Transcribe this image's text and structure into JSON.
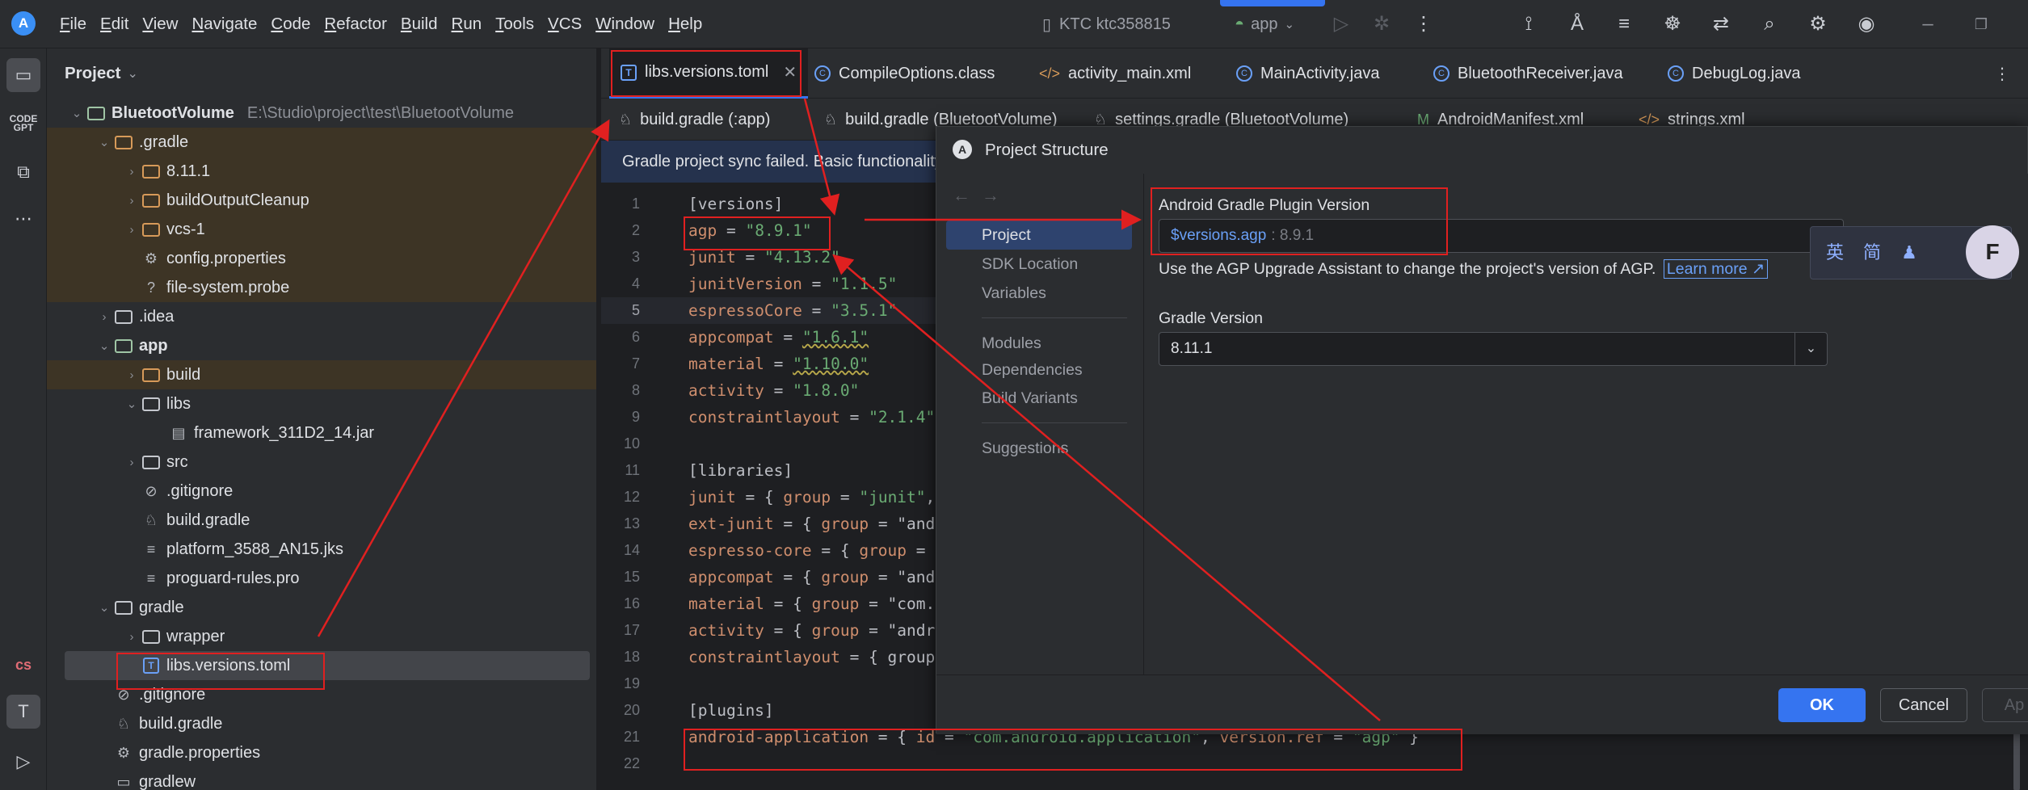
{
  "menu": [
    "File",
    "Edit",
    "View",
    "Navigate",
    "Code",
    "Refactor",
    "Build",
    "Run",
    "Tools",
    "VCS",
    "Window",
    "Help"
  ],
  "toolbar": {
    "device": "KTC ktc358815",
    "run_config": "app"
  },
  "project_panel": {
    "title": "Project",
    "rows": [
      {
        "label": "BluetootVolume",
        "path": "E:\\Studio\\project\\test\\BluetootVolume"
      },
      {
        "label": ".gradle"
      },
      {
        "label": "8.11.1"
      },
      {
        "label": "buildOutputCleanup"
      },
      {
        "label": "vcs-1"
      },
      {
        "label": "config.properties"
      },
      {
        "label": "file-system.probe"
      },
      {
        "label": ".idea"
      },
      {
        "label": "app"
      },
      {
        "label": "build"
      },
      {
        "label": "libs"
      },
      {
        "label": "framework_311D2_14.jar"
      },
      {
        "label": "src"
      },
      {
        "label": ".gitignore"
      },
      {
        "label": "build.gradle"
      },
      {
        "label": "platform_3588_AN15.jks"
      },
      {
        "label": "proguard-rules.pro"
      },
      {
        "label": "gradle"
      },
      {
        "label": "wrapper"
      },
      {
        "label": "libs.versions.toml"
      },
      {
        "label": ".gitignore"
      },
      {
        "label": "build.gradle"
      },
      {
        "label": "gradle.properties"
      },
      {
        "label": "gradlew"
      }
    ]
  },
  "editor_tabs": [
    "libs.versions.toml",
    "CompileOptions.class",
    "activity_main.xml",
    "MainActivity.java",
    "BluetoothReceiver.java",
    "DebugLog.java"
  ],
  "editor_tabs2": [
    "build.gradle (:app)",
    "build.gradle (BluetootVolume)",
    "settings.gradle (BluetootVolume)",
    "AndroidManifest.xml",
    "strings.xml"
  ],
  "banner": "Gradle project sync failed. Basic functionality",
  "code_lines": [
    {
      "n": "1",
      "t": "[versions]"
    },
    {
      "n": "2",
      "t": "agp = \"8.9.1\""
    },
    {
      "n": "3",
      "t": "junit = \"4.13.2\""
    },
    {
      "n": "4",
      "t": "junitVersion = \"1.1.5\""
    },
    {
      "n": "5",
      "t": "espressoCore = \"3.5.1\""
    },
    {
      "n": "6",
      "t": "appcompat = \"1.6.1\""
    },
    {
      "n": "7",
      "t": "material = \"1.10.0\""
    },
    {
      "n": "8",
      "t": "activity = \"1.8.0\""
    },
    {
      "n": "9",
      "t": "constraintlayout = \"2.1.4\""
    },
    {
      "n": "10",
      "t": ""
    },
    {
      "n": "11",
      "t": "[libraries]"
    },
    {
      "n": "12",
      "t": "junit = { group = \"junit\","
    },
    {
      "n": "13",
      "t": "ext-junit = { group = \"and"
    },
    {
      "n": "14",
      "t": "espresso-core = { group ="
    },
    {
      "n": "15",
      "t": "appcompat = { group = \"and"
    },
    {
      "n": "16",
      "t": "material = { group = \"com."
    },
    {
      "n": "17",
      "t": "activity = { group = \"andr"
    },
    {
      "n": "18",
      "t": "constraintlayout = { group"
    },
    {
      "n": "19",
      "t": ""
    },
    {
      "n": "20",
      "t": "[plugins]"
    },
    {
      "n": "21",
      "t": "android-application = { id = \"com.android.application\", version.ref = \"agp\" }"
    },
    {
      "n": "22",
      "t": ""
    }
  ],
  "dialog": {
    "title": "Project Structure",
    "nav": [
      "Project",
      "SDK Location",
      "Variables",
      "Modules",
      "Dependencies",
      "Build Variants",
      "Suggestions"
    ],
    "agp_label": "Android Gradle Plugin Version",
    "agp_value": "$versions.agp",
    "agp_resolved": ": 8.9.1",
    "hint": "Use the AGP Upgrade Assistant to change the project's version of AGP.",
    "learn_more": "Learn more ↗",
    "gradle_label": "Gradle Version",
    "gradle_value": "8.11.1",
    "ok": "OK",
    "cancel": "Cancel",
    "apply": "Ap"
  },
  "ime": [
    "英",
    "简"
  ]
}
